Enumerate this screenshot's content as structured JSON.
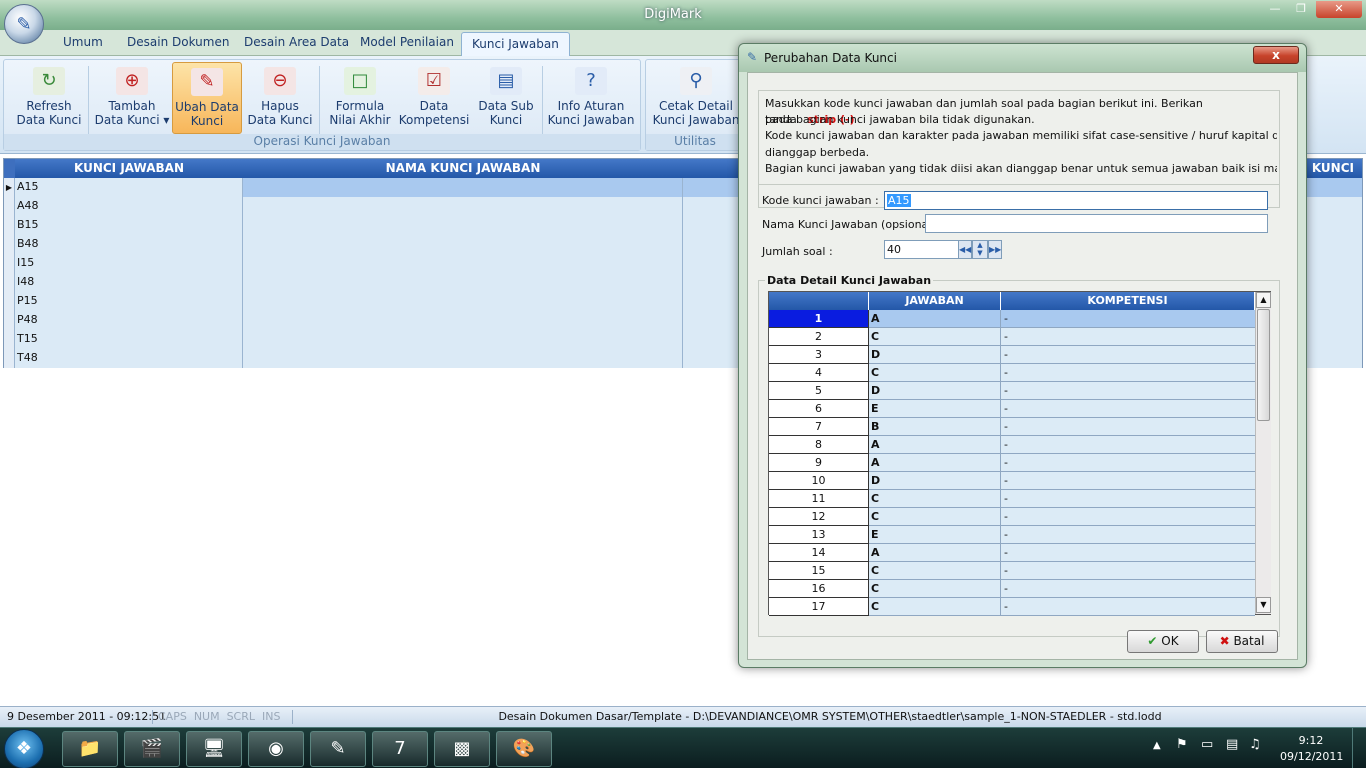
{
  "app": {
    "title": "DigiMark"
  },
  "ribbon": {
    "tabs": [
      "Umum",
      "Desain Dokumen",
      "Desain Area Data",
      "Model Penilaian",
      "Kunci Jawaban"
    ],
    "active_tab": "Kunci Jawaban",
    "groups": [
      {
        "label": "Operasi Kunci Jawaban"
      },
      {
        "label": "Utilitas"
      }
    ],
    "buttons": [
      {
        "line1": "Refresh",
        "line2": "Data Kunci"
      },
      {
        "line1": "Tambah",
        "line2": "Data Kunci ▾"
      },
      {
        "line1": "Ubah Data",
        "line2": "Kunci"
      },
      {
        "line1": "Hapus",
        "line2": "Data Kunci"
      },
      {
        "line1": "Formula",
        "line2": "Nilai Akhir"
      },
      {
        "line1": "Data",
        "line2": "Kompetensi"
      },
      {
        "line1": "Data Sub",
        "line2": "Kunci"
      },
      {
        "line1": "Info Aturan",
        "line2": "Kunci Jawaban"
      },
      {
        "line1": "Cetak Detail",
        "line2": "Kunci Jawaban"
      }
    ]
  },
  "main_grid": {
    "headers": [
      "KUNCI JAWABAN",
      "NAMA KUNCI JAWABAN",
      "B KUNCI"
    ],
    "rows": [
      "A15",
      "A48",
      "B15",
      "B48",
      "I15",
      "I48",
      "P15",
      "P48",
      "T15",
      "T48"
    ]
  },
  "dialog": {
    "title": "Perubahan Data Kunci",
    "close_label": "x",
    "info": {
      "line1": "Masukkan kode kunci jawaban dan jumlah soal pada bagian berikut ini. Berikan tanda",
      "strip": "strip (-)",
      "line2": "pada bagian kunci jawaban bila tidak digunakan.",
      "line3": "Kode kunci jawaban dan karakter pada jawaban memiliki sifat case-sensitive / huruf kapital dan huruf kecil",
      "line4": "dianggap berbeda.",
      "line5": "Bagian kunci jawaban yang tidak diisi akan dianggap benar untuk semua jawaban baik isi maupun kosong."
    },
    "fields": {
      "kode_label": "Kode kunci jawaban :",
      "kode_value": "A15",
      "nama_label": "Nama Kunci Jawaban (opsional) :",
      "nama_value": "",
      "jumlah_label": "Jumlah soal :",
      "jumlah_value": "40"
    },
    "detail": {
      "legend": "Data Detail Kunci Jawaban",
      "headers": [
        "",
        "JAWABAN",
        "KOMPETENSI"
      ],
      "rows": [
        {
          "no": "1",
          "jawaban": "A",
          "kompetensi": "-"
        },
        {
          "no": "2",
          "jawaban": "C",
          "kompetensi": "-"
        },
        {
          "no": "3",
          "jawaban": "D",
          "kompetensi": "-"
        },
        {
          "no": "4",
          "jawaban": "C",
          "kompetensi": "-"
        },
        {
          "no": "5",
          "jawaban": "D",
          "kompetensi": "-"
        },
        {
          "no": "6",
          "jawaban": "E",
          "kompetensi": "-"
        },
        {
          "no": "7",
          "jawaban": "B",
          "kompetensi": "-"
        },
        {
          "no": "8",
          "jawaban": "A",
          "kompetensi": "-"
        },
        {
          "no": "9",
          "jawaban": "A",
          "kompetensi": "-"
        },
        {
          "no": "10",
          "jawaban": "D",
          "kompetensi": "-"
        },
        {
          "no": "11",
          "jawaban": "C",
          "kompetensi": "-"
        },
        {
          "no": "12",
          "jawaban": "C",
          "kompetensi": "-"
        },
        {
          "no": "13",
          "jawaban": "E",
          "kompetensi": "-"
        },
        {
          "no": "14",
          "jawaban": "A",
          "kompetensi": "-"
        },
        {
          "no": "15",
          "jawaban": "C",
          "kompetensi": "-"
        },
        {
          "no": "16",
          "jawaban": "C",
          "kompetensi": "-"
        },
        {
          "no": "17",
          "jawaban": "C",
          "kompetensi": "-"
        }
      ]
    },
    "ok_label": "OK",
    "cancel_label": "Batal"
  },
  "status": {
    "datetime": "9 Desember 2011 - 09:12:51",
    "keys": "CAPS  NUM  SCRL  INS",
    "document": "Desain Dokumen Dasar/Template - D:\\DEVANDIANCE\\OMR SYSTEM\\OTHER\\staedtler\\sample_1-NON-STAEDLER - std.lodd"
  },
  "taskbar": {
    "time": "9:12",
    "date": "09/12/2011"
  },
  "colors": {
    "accent": "#2357a8",
    "strip_red": "#d01010",
    "active_orange": "#f7b65a"
  }
}
